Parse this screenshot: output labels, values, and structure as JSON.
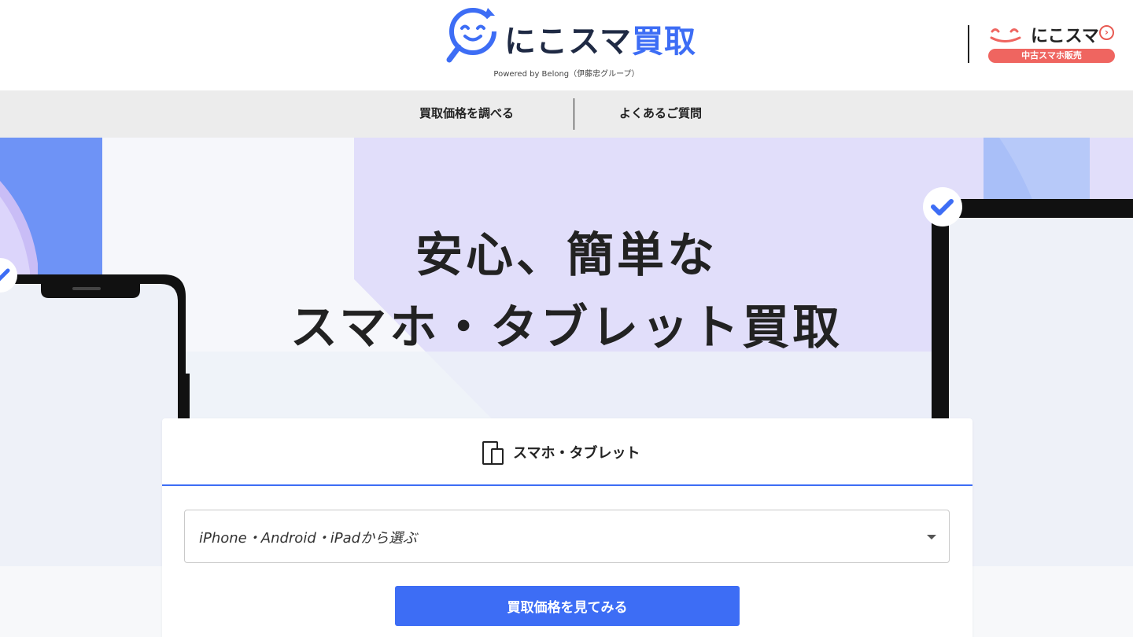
{
  "header": {
    "logo_text_main": "にこスマ",
    "logo_text_accent": "買取",
    "powered_by": "Powered by Belong（伊藤忠グループ）",
    "niko_link": {
      "text": "にこスマ",
      "badge": "中古スマホ販売",
      "chevron": "›"
    }
  },
  "nav": {
    "items": [
      {
        "label": "買取価格を調べる"
      },
      {
        "label": "よくあるご質問"
      }
    ]
  },
  "hero": {
    "title_line1": "安心、簡単な",
    "title_line2": "スマホ・タブレット買取"
  },
  "search": {
    "tab_label": "スマホ・タブレット",
    "tab_icon": "phone-tablet-icon",
    "select_value": "iPhone・Android・iPadから選ぶ",
    "button_label": "買取価格を見てみる"
  },
  "colors": {
    "accent": "#3d6df5",
    "lavender": "#e1defa",
    "purple": "#c4bbf7",
    "light_blue": "#a9bff8",
    "badge_red": "#ef6560"
  }
}
